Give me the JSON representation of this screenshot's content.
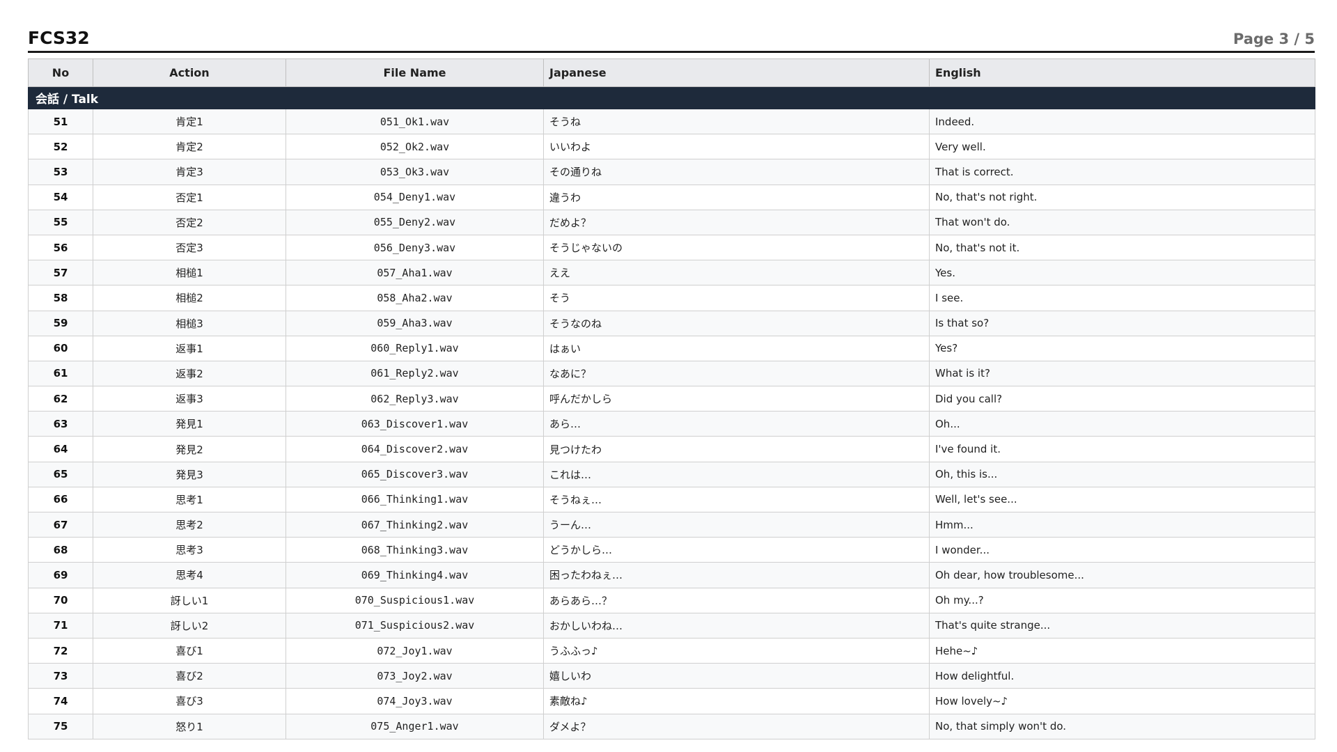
{
  "header": {
    "title": "FCS32",
    "page": "Page 3 / 5"
  },
  "table": {
    "columns": [
      "No",
      "Action",
      "File Name",
      "Japanese",
      "English"
    ],
    "section": "会話 / Talk",
    "rows": [
      {
        "no": "51",
        "action": "肯定1",
        "file": "051_Ok1.wav",
        "ja": "そうね",
        "en": "Indeed."
      },
      {
        "no": "52",
        "action": "肯定2",
        "file": "052_Ok2.wav",
        "ja": "いいわよ",
        "en": "Very well."
      },
      {
        "no": "53",
        "action": "肯定3",
        "file": "053_Ok3.wav",
        "ja": "その通りね",
        "en": "That is correct."
      },
      {
        "no": "54",
        "action": "否定1",
        "file": "054_Deny1.wav",
        "ja": "違うわ",
        "en": "No, that's not right."
      },
      {
        "no": "55",
        "action": "否定2",
        "file": "055_Deny2.wav",
        "ja": "だめよ？",
        "en": "That won't do."
      },
      {
        "no": "56",
        "action": "否定3",
        "file": "056_Deny3.wav",
        "ja": "そうじゃないの",
        "en": "No, that's not it."
      },
      {
        "no": "57",
        "action": "相槌1",
        "file": "057_Aha1.wav",
        "ja": "ええ",
        "en": "Yes."
      },
      {
        "no": "58",
        "action": "相槌2",
        "file": "058_Aha2.wav",
        "ja": "そう",
        "en": "I see."
      },
      {
        "no": "59",
        "action": "相槌3",
        "file": "059_Aha3.wav",
        "ja": "そうなのね",
        "en": "Is that so?"
      },
      {
        "no": "60",
        "action": "返事1",
        "file": "060_Reply1.wav",
        "ja": "はぁい",
        "en": "Yes?"
      },
      {
        "no": "61",
        "action": "返事2",
        "file": "061_Reply2.wav",
        "ja": "なあに？",
        "en": "What is it?"
      },
      {
        "no": "62",
        "action": "返事3",
        "file": "062_Reply3.wav",
        "ja": "呼んだかしら",
        "en": "Did you call?"
      },
      {
        "no": "63",
        "action": "発見1",
        "file": "063_Discover1.wav",
        "ja": "あら…",
        "en": "Oh..."
      },
      {
        "no": "64",
        "action": "発見2",
        "file": "064_Discover2.wav",
        "ja": "見つけたわ",
        "en": "I've found it."
      },
      {
        "no": "65",
        "action": "発見3",
        "file": "065_Discover3.wav",
        "ja": "これは…",
        "en": "Oh, this is..."
      },
      {
        "no": "66",
        "action": "思考1",
        "file": "066_Thinking1.wav",
        "ja": "そうねぇ…",
        "en": "Well, let's see..."
      },
      {
        "no": "67",
        "action": "思考2",
        "file": "067_Thinking2.wav",
        "ja": "うーん…",
        "en": "Hmm..."
      },
      {
        "no": "68",
        "action": "思考3",
        "file": "068_Thinking3.wav",
        "ja": "どうかしら…",
        "en": "I wonder..."
      },
      {
        "no": "69",
        "action": "思考4",
        "file": "069_Thinking4.wav",
        "ja": "困ったわねぇ…",
        "en": "Oh dear, how troublesome..."
      },
      {
        "no": "70",
        "action": "訝しい1",
        "file": "070_Suspicious1.wav",
        "ja": "あらあら…？",
        "en": "Oh my...?"
      },
      {
        "no": "71",
        "action": "訝しい2",
        "file": "071_Suspicious2.wav",
        "ja": "おかしいわね…",
        "en": "That's quite strange..."
      },
      {
        "no": "72",
        "action": "喜び1",
        "file": "072_Joy1.wav",
        "ja": "うふふっ♪",
        "en": "Hehe~♪"
      },
      {
        "no": "73",
        "action": "喜び2",
        "file": "073_Joy2.wav",
        "ja": "嬉しいわ",
        "en": "How delightful."
      },
      {
        "no": "74",
        "action": "喜び3",
        "file": "074_Joy3.wav",
        "ja": "素敵ね♪",
        "en": "How lovely~♪"
      },
      {
        "no": "75",
        "action": "怒り1",
        "file": "075_Anger1.wav",
        "ja": "ダメよ？",
        "en": "No, that simply won't do."
      }
    ]
  }
}
